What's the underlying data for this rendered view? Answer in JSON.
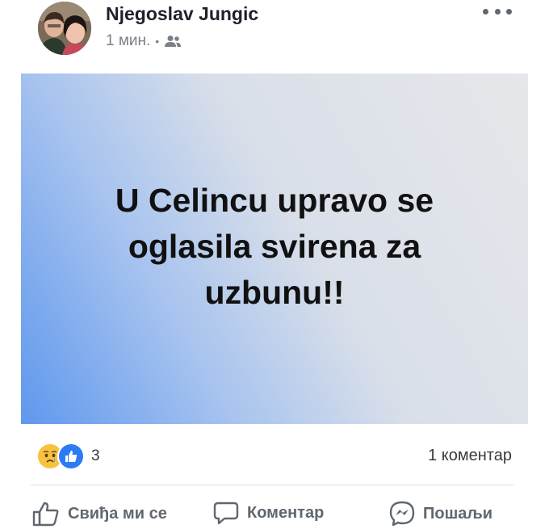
{
  "post": {
    "author": "Njegoslav Jungic",
    "time": "1 мин.",
    "separator": "•",
    "audience_icon": "friends-icon",
    "text": "U Celincu upravo se oglasila svirena za uzbunu!!",
    "background_gradient": [
      "#5f98ee",
      "#e6e7ea"
    ]
  },
  "stats": {
    "reaction_icons": [
      "sad-reaction-icon",
      "like-reaction-icon"
    ],
    "reaction_count": "3",
    "comments": "1 коментар"
  },
  "actions": {
    "like_label": "Свиђа ми се",
    "comment_label": "Коментар",
    "share_label": "Пошаљи"
  },
  "colors": {
    "like_blue": "#2d7bf4",
    "sad_yellow": "#f7c23f",
    "secondary_text": "#606770"
  }
}
